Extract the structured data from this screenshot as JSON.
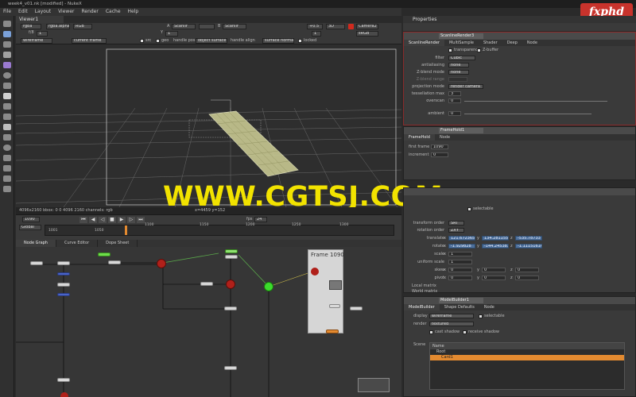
{
  "window": {
    "title": "week4_v01.nk [modified] - NukeX"
  },
  "menu": [
    "File",
    "Edit",
    "Layout",
    "Viewer",
    "Render",
    "Cache",
    "Help"
  ],
  "viewer": {
    "tab": "Viewer1",
    "channels": "rgba",
    "alpha": "rgba.alpha",
    "colorspace_in": "RGB",
    "a_input": "A",
    "a_node": "Scanlir",
    "b_input": "B",
    "b_node": "Scanlir",
    "gain_label": "f/8",
    "gain": "1",
    "gamma_label": "Y",
    "gamma": "1",
    "exposure": "+0.5",
    "mode": "3D",
    "camera": "Camera2",
    "display_lut": "sRGB",
    "proxy": "1",
    "display": "wireframe",
    "frame": "current frame",
    "src_label": "src",
    "geo_label": "geo",
    "handle_pos_label": "handle pos",
    "handle_pos": "object surface",
    "handle_align_label": "handle align",
    "handle_align": "surface normal",
    "locked_label": "locked",
    "status": "4096x2160  bbox: 0 0 4096 2160  channels: rgb",
    "coords": "x=4459 y=152"
  },
  "timeline": {
    "fps_label": "fps",
    "fps": "24",
    "current_frame": "1090",
    "play_range": "Global",
    "ticks": [
      "1001",
      "1050",
      "1100",
      "1150",
      "1200",
      "1250",
      "1300"
    ]
  },
  "nodegraph": {
    "tabs": [
      "Node Graph",
      "Curve Editor",
      "Dope Sheet"
    ],
    "framehold_label": "Frame 1090"
  },
  "properties": {
    "title": "Properties",
    "scanline": {
      "name": "ScanlineRender3",
      "tabs": [
        "ScanlineRender",
        "MultiSample",
        "Shader",
        "Deep",
        "Node"
      ],
      "transparency_label": "transparency",
      "zbuffer_label": "Z-buffer",
      "filter_label": "filter",
      "filter": "Cubic",
      "antialiasing_label": "antialiasing",
      "antialiasing": "none",
      "zblend_mode_label": "Z-blend mode",
      "zblend_mode": "none",
      "zblend_range_label": "Z-blend range",
      "projection_mode_label": "projection mode",
      "projection_mode": "render camera",
      "tessellation_label": "tessellation max",
      "tessellation": "3",
      "overscan_label": "overscan",
      "overscan": "0",
      "ambient_label": "ambient",
      "ambient": "0"
    },
    "framehold": {
      "name": "FrameHold1",
      "tabs": [
        "FrameHold",
        "Node"
      ],
      "first_frame_label": "first frame",
      "first_frame": "1090",
      "increment_label": "increment",
      "increment": "0"
    },
    "card": {
      "selectable_label": "selectable",
      "transform_order_label": "transform order",
      "transform_order": "SRT",
      "rotation_order_label": "rotation order",
      "rotation_order": "ZXY",
      "translate_label": "translate",
      "translate": [
        "121.672365",
        "134.281155",
        "-535.78733"
      ],
      "rotate_label": "rotate",
      "rotate": [
        "-1.929828",
        "-144.245383",
        "-1.11151616"
      ],
      "scale_label": "scale",
      "scale": "1",
      "uniform_scale_label": "uniform scale",
      "uniform_scale": "1",
      "skew_label": "skew",
      "skew": [
        "0",
        "0",
        "0"
      ],
      "pivot_label": "pivot",
      "pivot": [
        "0",
        "0",
        "0"
      ],
      "local_matrix": "Local matrix",
      "world_matrix": "World matrix",
      "axis_x": "x",
      "axis_y": "y",
      "axis_z": "z"
    },
    "modelbuilder": {
      "name": "ModelBuilder1",
      "tabs": [
        "ModelBuilder",
        "Shape Defaults",
        "Node"
      ],
      "display_label": "display",
      "display": "wireframe",
      "selectable_label": "selectable",
      "render_label": "render",
      "render": "textured",
      "cast_shadow_label": "cast shadow",
      "receive_shadow_label": "receive shadow",
      "scene_label": "Scene",
      "scene_column": "Name",
      "scene_items": [
        "Root",
        "Card1"
      ]
    }
  },
  "watermark": "WWW.CGTSJ.COM",
  "logo": "fxphd",
  "colors": {
    "accent_orange": "#e38a30",
    "selected_blue": "#4d6f9a",
    "watermark": "#f2e300",
    "node_red": "#b0201a",
    "node_green": "#3cdc2c"
  }
}
